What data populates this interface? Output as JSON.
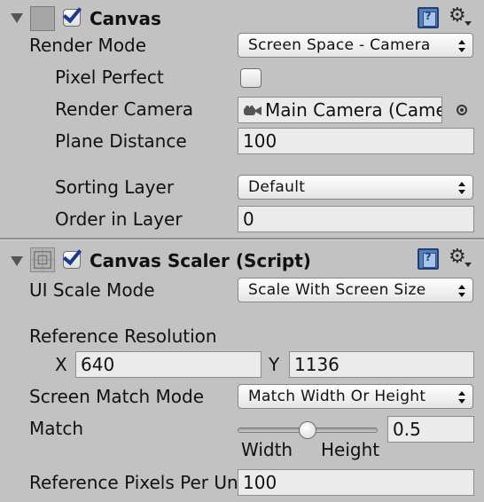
{
  "canvas": {
    "title": "Canvas",
    "enabled": true,
    "render_mode": {
      "label": "Render Mode",
      "value": "Screen Space - Camera"
    },
    "pixel_perfect": {
      "label": "Pixel Perfect",
      "checked": false
    },
    "render_camera": {
      "label": "Render Camera",
      "value": "Main Camera (Camera)"
    },
    "plane_distance": {
      "label": "Plane Distance",
      "value": "100"
    },
    "sorting_layer": {
      "label": "Sorting Layer",
      "value": "Default"
    },
    "order_in_layer": {
      "label": "Order in Layer",
      "value": "0"
    }
  },
  "canvas_scaler": {
    "title": "Canvas Scaler (Script)",
    "enabled": true,
    "ui_scale_mode": {
      "label": "UI Scale Mode",
      "value": "Scale With Screen Size"
    },
    "reference_resolution": {
      "label": "Reference Resolution",
      "x_label": "X",
      "x_value": "640",
      "y_label": "Y",
      "y_value": "1136"
    },
    "screen_match_mode": {
      "label": "Screen Match Mode",
      "value": "Match Width Or Height"
    },
    "match": {
      "label": "Match",
      "value": "0.5",
      "level": 0.5,
      "min_label": "Width",
      "max_label": "Height"
    },
    "reference_pixels_per_unit": {
      "label": "Reference Pixels Per Unit",
      "value": "100"
    }
  },
  "colors": {
    "background": "#c2c2c2",
    "checkmark": "#1a3a8c",
    "help_book": "#5a7fb8"
  },
  "icons": [
    "foldout-arrow-icon",
    "canvas-component-icon",
    "canvas-scaler-component-icon",
    "help-book-icon",
    "gear-icon",
    "camera-icon",
    "object-picker-icon"
  ]
}
